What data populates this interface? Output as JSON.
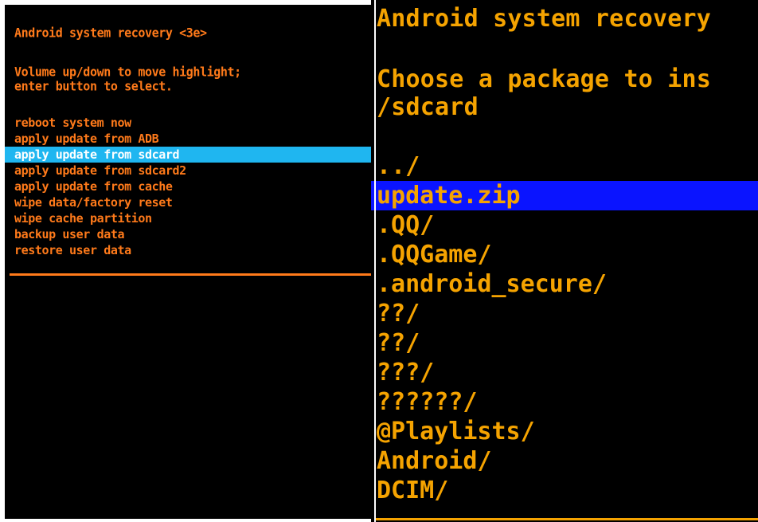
{
  "left_screen": {
    "title": "Android system recovery <3e>",
    "instructions": [
      "Volume up/down to move highlight;",
      "enter button to select."
    ],
    "menu": [
      {
        "label": "reboot system now",
        "selected": false
      },
      {
        "label": "apply update from ADB",
        "selected": false
      },
      {
        "label": "apply update from sdcard",
        "selected": true
      },
      {
        "label": "apply update from sdcard2",
        "selected": false
      },
      {
        "label": "apply update from cache",
        "selected": false
      },
      {
        "label": "wipe data/factory reset",
        "selected": false
      },
      {
        "label": "wipe cache partition",
        "selected": false
      },
      {
        "label": "backup user data",
        "selected": false
      },
      {
        "label": "restore user data",
        "selected": false
      }
    ],
    "colors": {
      "text": "#ff7a1a",
      "highlight": "#1fb6f0",
      "highlight_text": "#ffffff"
    }
  },
  "right_screen": {
    "title": "Android system recovery",
    "prompt": "Choose a package to ins",
    "path": "/sdcard",
    "files": [
      {
        "label": "../",
        "selected": false
      },
      {
        "label": "update.zip",
        "selected": true
      },
      {
        "label": ".QQ/",
        "selected": false
      },
      {
        "label": ".QQGame/",
        "selected": false
      },
      {
        "label": ".android_secure/",
        "selected": false
      },
      {
        "label": "??/",
        "selected": false
      },
      {
        "label": "??/",
        "selected": false
      },
      {
        "label": "???/",
        "selected": false
      },
      {
        "label": "??????/",
        "selected": false
      },
      {
        "label": "@Playlists/",
        "selected": false
      },
      {
        "label": "Android/",
        "selected": false
      },
      {
        "label": "DCIM/",
        "selected": false
      }
    ],
    "colors": {
      "text": "#f5a300",
      "highlight": "#0a14ff"
    }
  }
}
